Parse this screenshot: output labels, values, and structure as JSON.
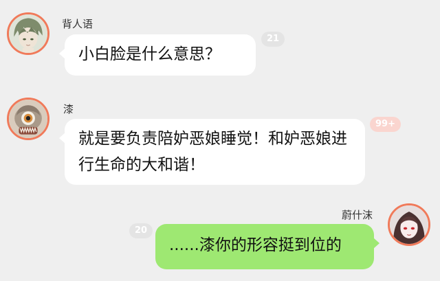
{
  "messages": [
    {
      "sender": "背人语",
      "text": "小白脸是什么意思？",
      "badge": "21",
      "side": "left"
    },
    {
      "sender": "漆",
      "text": "就是要负责陪妒恶娘睡觉！和妒恶娘进行生命的大和谐！",
      "badge": "99+",
      "side": "left"
    },
    {
      "sender": "蔚什沫",
      "text": "......漆你的形容挺到位的",
      "badge": "20",
      "side": "right"
    }
  ],
  "colors": {
    "background": "#efefef",
    "left_bubble": "#ffffff",
    "right_bubble": "#9ee872",
    "avatar_ring": "#f07a5a",
    "badge": "#e4e4e4",
    "badge_hot": "#fad5cf"
  },
  "icons": [
    "avatar-green-hair-boy",
    "avatar-monster-eye",
    "avatar-red-eye-girl"
  ]
}
